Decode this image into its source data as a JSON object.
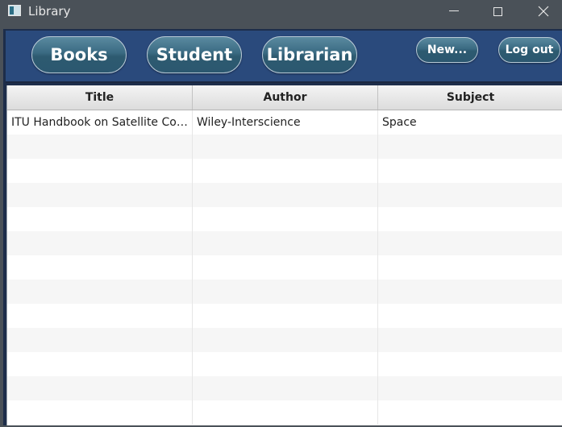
{
  "window": {
    "title": "Library",
    "icon": "library-app-icon"
  },
  "navbar": {
    "books_label": "Books",
    "student_label": "Student",
    "librarian_label": "Librarian",
    "new_label": "New...",
    "logout_label": "Log out"
  },
  "table": {
    "columns": [
      "Title",
      "Author",
      "Subject"
    ],
    "rows": [
      [
        "ITU Handbook on Satellite Communications",
        "Wiley-Interscience",
        "Space"
      ]
    ],
    "visible_row_count": 13
  },
  "colors": {
    "navbar_bg": "#2a4a7c",
    "button_bg": "#3a6a82",
    "titlebar_bg": "#4a5158"
  }
}
